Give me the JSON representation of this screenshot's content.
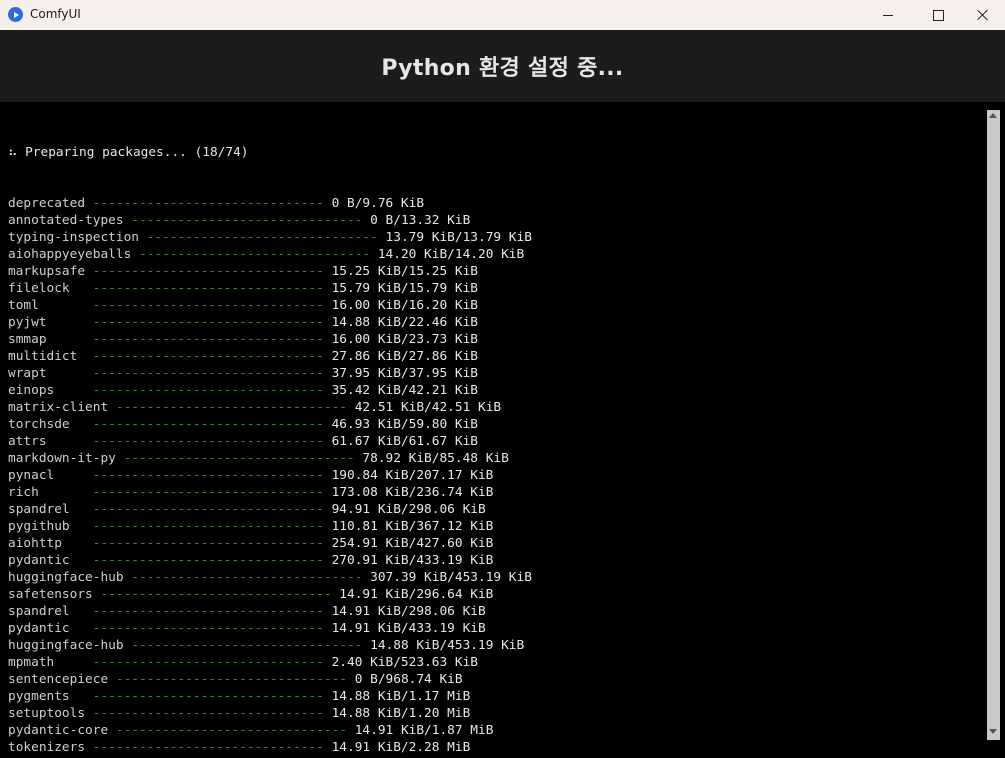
{
  "window": {
    "title": "ComfyUI",
    "header": "Python 환경 설정 중..."
  },
  "terminal": {
    "status_line": "⠦ Preparing packages... (18/74)",
    "packages": [
      {
        "name": "deprecated",
        "size": "0 B/9.76 KiB"
      },
      {
        "name": "annotated-types",
        "size": "0 B/13.32 KiB"
      },
      {
        "name": "typing-inspection",
        "size": "13.79 KiB/13.79 KiB"
      },
      {
        "name": "aiohappyeyeballs",
        "size": "14.20 KiB/14.20 KiB"
      },
      {
        "name": "markupsafe",
        "size": "15.25 KiB/15.25 KiB"
      },
      {
        "name": "filelock",
        "size": "15.79 KiB/15.79 KiB"
      },
      {
        "name": "toml",
        "size": "16.00 KiB/16.20 KiB"
      },
      {
        "name": "pyjwt",
        "size": "14.88 KiB/22.46 KiB"
      },
      {
        "name": "smmap",
        "size": "16.00 KiB/23.73 KiB"
      },
      {
        "name": "multidict",
        "size": "27.86 KiB/27.86 KiB"
      },
      {
        "name": "wrapt",
        "size": "37.95 KiB/37.95 KiB"
      },
      {
        "name": "einops",
        "size": "35.42 KiB/42.21 KiB"
      },
      {
        "name": "matrix-client",
        "size": "42.51 KiB/42.51 KiB"
      },
      {
        "name": "torchsde",
        "size": "46.93 KiB/59.80 KiB"
      },
      {
        "name": "attrs",
        "size": "61.67 KiB/61.67 KiB"
      },
      {
        "name": "markdown-it-py",
        "size": "78.92 KiB/85.48 KiB"
      },
      {
        "name": "pynacl",
        "size": "190.84 KiB/207.17 KiB"
      },
      {
        "name": "rich",
        "size": "173.08 KiB/236.74 KiB"
      },
      {
        "name": "spandrel",
        "size": "94.91 KiB/298.06 KiB"
      },
      {
        "name": "pygithub",
        "size": "110.81 KiB/367.12 KiB"
      },
      {
        "name": "aiohttp",
        "size": "254.91 KiB/427.60 KiB"
      },
      {
        "name": "pydantic",
        "size": "270.91 KiB/433.19 KiB"
      },
      {
        "name": "huggingface-hub",
        "size": "307.39 KiB/453.19 KiB"
      },
      {
        "name": "safetensors",
        "size": "14.91 KiB/296.64 KiB"
      },
      {
        "name": "spandrel",
        "size": "14.91 KiB/298.06 KiB"
      },
      {
        "name": "pydantic",
        "size": "14.91 KiB/433.19 KiB"
      },
      {
        "name": "huggingface-hub",
        "size": "14.88 KiB/453.19 KiB"
      },
      {
        "name": "mpmath",
        "size": "2.40 KiB/523.63 KiB"
      },
      {
        "name": "sentencepiece",
        "size": "0 B/968.74 KiB"
      },
      {
        "name": "pygments",
        "size": "14.88 KiB/1.17 MiB"
      },
      {
        "name": "setuptools",
        "size": "14.88 KiB/1.20 MiB"
      },
      {
        "name": "pydantic-core",
        "size": "14.91 KiB/1.87 MiB"
      },
      {
        "name": "tokenizers",
        "size": "14.91 KiB/2.28 MiB"
      }
    ]
  },
  "colors": {
    "titlebar": "#f7efec",
    "header_bg": "#1c1c1c",
    "terminal_bg": "#000000",
    "progress_bar": "#3d8a3d"
  },
  "icons": {
    "app": "comfyui-logo-icon",
    "minimize": "minimize-icon",
    "maximize": "maximize-icon",
    "close": "close-icon"
  }
}
